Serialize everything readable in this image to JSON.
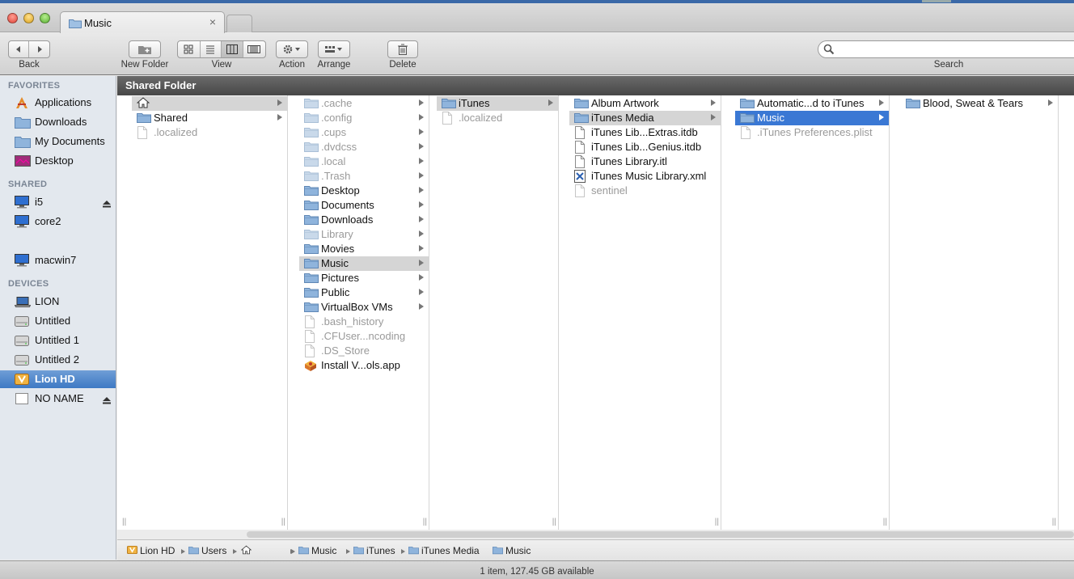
{
  "window": {
    "tab_title": "Music",
    "tab_close": "×"
  },
  "toolbar": {
    "back_label": "Back",
    "new_folder_label": "New Folder",
    "view_label": "View",
    "action_label": "Action",
    "arrange_label": "Arrange",
    "delete_label": "Delete",
    "search_label": "Search",
    "search_placeholder": ""
  },
  "sidebar": {
    "favorites_header": "FAVORITES",
    "favorites": [
      {
        "label": "Applications",
        "icon": "applications-icon"
      },
      {
        "label": "Downloads",
        "icon": "folder-icon"
      },
      {
        "label": "My Documents",
        "icon": "folder-icon"
      },
      {
        "label": "Desktop",
        "icon": "desktop-icon"
      }
    ],
    "shared_header": "SHARED",
    "shared": [
      {
        "label": "i5",
        "icon": "computer-icon"
      },
      {
        "label": "core2",
        "icon": "computer-icon"
      },
      {
        "label": "macwin7",
        "icon": "computer-icon"
      }
    ],
    "devices_header": "DEVICES",
    "devices": [
      {
        "label": "LION",
        "icon": "laptop-icon"
      },
      {
        "label": "Untitled",
        "icon": "disk-icon"
      },
      {
        "label": "Untitled 1",
        "icon": "disk-icon"
      },
      {
        "label": "Untitled 2",
        "icon": "disk-icon"
      },
      {
        "label": "Lion HD",
        "icon": "lion-disk-icon",
        "selected": true
      },
      {
        "label": "NO NAME",
        "icon": "removable-disk-icon"
      }
    ]
  },
  "path_header": "Shared Folder",
  "columns": [
    {
      "rows": [
        {
          "label": "",
          "kind": "home",
          "arrow": true,
          "state": "hl"
        },
        {
          "label": "Shared",
          "kind": "folder",
          "arrow": true
        },
        {
          "label": ".localized",
          "kind": "file",
          "dim": true
        }
      ]
    },
    {
      "rows": [
        {
          "label": ".cache",
          "kind": "folder",
          "arrow": true,
          "dim": true
        },
        {
          "label": ".config",
          "kind": "folder",
          "arrow": true,
          "dim": true
        },
        {
          "label": ".cups",
          "kind": "folder",
          "arrow": true,
          "dim": true
        },
        {
          "label": ".dvdcss",
          "kind": "folder",
          "arrow": true,
          "dim": true
        },
        {
          "label": ".local",
          "kind": "folder",
          "arrow": true,
          "dim": true
        },
        {
          "label": ".Trash",
          "kind": "folder",
          "arrow": true,
          "dim": true
        },
        {
          "label": "Desktop",
          "kind": "folder",
          "arrow": true
        },
        {
          "label": "Documents",
          "kind": "folder",
          "arrow": true
        },
        {
          "label": "Downloads",
          "kind": "folder",
          "arrow": true
        },
        {
          "label": "Library",
          "kind": "folder",
          "arrow": true,
          "dim": true
        },
        {
          "label": "Movies",
          "kind": "folder",
          "arrow": true
        },
        {
          "label": "Music",
          "kind": "folder",
          "arrow": true,
          "state": "hl"
        },
        {
          "label": "Pictures",
          "kind": "folder",
          "arrow": true
        },
        {
          "label": "Public",
          "kind": "folder",
          "arrow": true
        },
        {
          "label": "VirtualBox VMs",
          "kind": "folder",
          "arrow": true
        },
        {
          "label": ".bash_history",
          "kind": "file",
          "dim": true
        },
        {
          "label": ".CFUser...ncoding",
          "kind": "file",
          "dim": true
        },
        {
          "label": ".DS_Store",
          "kind": "file",
          "dim": true
        },
        {
          "label": "Install V...ols.app",
          "kind": "app"
        }
      ]
    },
    {
      "rows": [
        {
          "label": "iTunes",
          "kind": "folder",
          "arrow": true,
          "state": "hl"
        },
        {
          "label": ".localized",
          "kind": "file",
          "dim": true
        }
      ]
    },
    {
      "rows": [
        {
          "label": "Album Artwork",
          "kind": "folder",
          "arrow": true
        },
        {
          "label": "iTunes Media",
          "kind": "folder",
          "arrow": true,
          "state": "hl"
        },
        {
          "label": "iTunes Lib...Extras.itdb",
          "kind": "file"
        },
        {
          "label": "iTunes Lib...Genius.itdb",
          "kind": "file"
        },
        {
          "label": "iTunes Library.itl",
          "kind": "file"
        },
        {
          "label": "iTunes Music Library.xml",
          "kind": "xml"
        },
        {
          "label": "sentinel",
          "kind": "file",
          "dim": true
        }
      ]
    },
    {
      "rows": [
        {
          "label": "Automatic...d to iTunes",
          "kind": "folder",
          "arrow": true
        },
        {
          "label": "Music",
          "kind": "folder",
          "arrow": true,
          "state": "sel"
        },
        {
          "label": ".iTunes Preferences.plist",
          "kind": "file",
          "dim": true
        }
      ]
    },
    {
      "rows": [
        {
          "label": "Blood, Sweat & Tears",
          "kind": "folder",
          "arrow": true
        }
      ]
    }
  ],
  "path_bar": [
    {
      "label": "Lion HD",
      "icon": "lion-disk-icon"
    },
    {
      "label": "Users",
      "icon": "folder-icon"
    },
    {
      "label": "",
      "icon": "home-icon"
    },
    {
      "label": "Music",
      "icon": "folder-icon"
    },
    {
      "label": "iTunes",
      "icon": "folder-icon"
    },
    {
      "label": "iTunes Media",
      "icon": "folder-icon"
    },
    {
      "label": "Music",
      "icon": "folder-icon"
    }
  ],
  "status": "1 item, 127.45 GB available",
  "colors": {
    "selection": "#3a78d4",
    "sidebar_selection": "#3e79c4",
    "folder": "#8fb4dc"
  }
}
